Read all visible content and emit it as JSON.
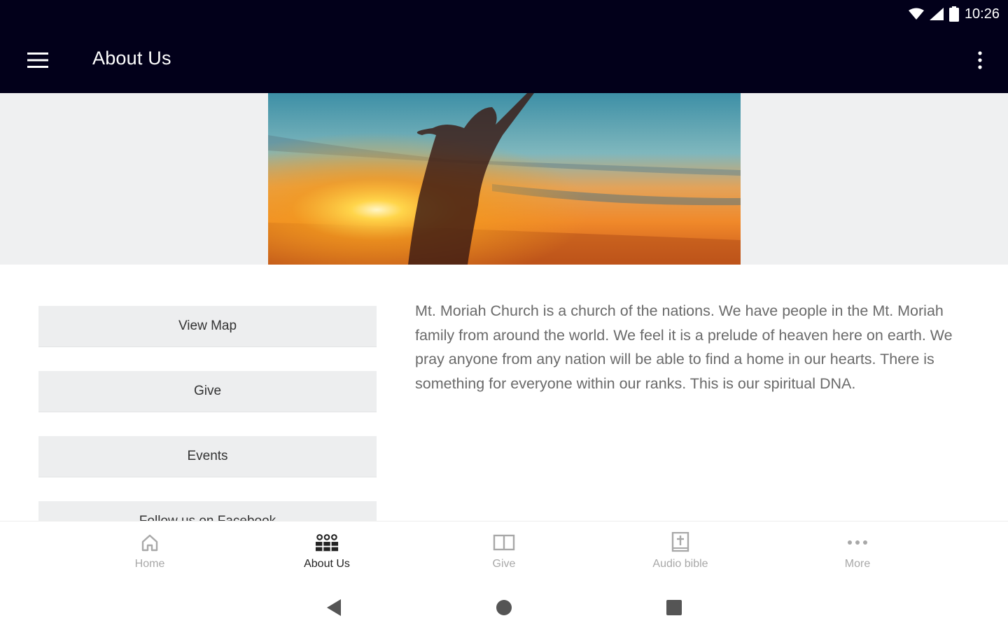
{
  "status_bar": {
    "time": "10:26"
  },
  "app_bar": {
    "title": "About Us"
  },
  "actions": [
    {
      "label": "View Map"
    },
    {
      "label": "Give"
    },
    {
      "label": "Events"
    },
    {
      "label": "Follow us on Facebook"
    }
  ],
  "description": "Mt. Moriah Church is a church of the nations.  We have people in the Mt. Moriah family from around the world.  We feel it is a prelude of heaven here on earth.  We pray anyone from any nation will be able to find a home in our hearts.  There is something for everyone within our ranks.  This is our spiritual DNA.",
  "bottom_nav": {
    "items": [
      {
        "label": "Home",
        "icon": "home-icon"
      },
      {
        "label": "About Us",
        "icon": "people-icon",
        "active": true
      },
      {
        "label": "Give",
        "icon": "book-open-icon"
      },
      {
        "label": "Audio bible",
        "icon": "bible-icon"
      },
      {
        "label": "More",
        "icon": "more-horiz-icon"
      }
    ]
  },
  "colors": {
    "app_bar_bg": "#02001a",
    "button_bg": "#edeeef",
    "hero_band_bg": "#eff0f1"
  }
}
